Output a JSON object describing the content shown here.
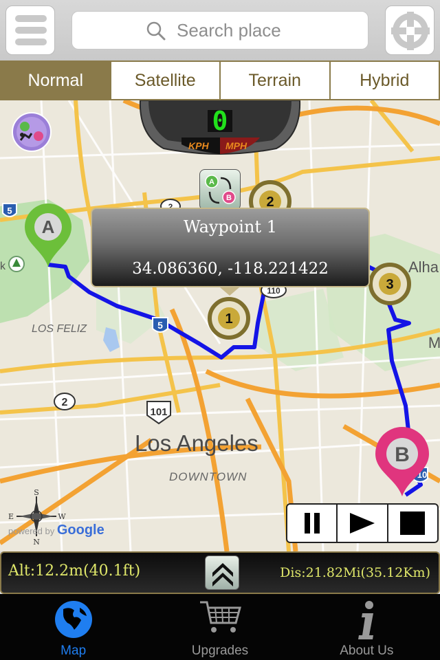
{
  "search": {
    "placeholder": "Search place"
  },
  "map_types": {
    "items": [
      "Normal",
      "Satellite",
      "Terrain",
      "Hybrid"
    ],
    "selected": "Normal"
  },
  "speed": {
    "value": "0",
    "unit_kph": "KPH",
    "unit_mph": "MPH"
  },
  "popup": {
    "title": "Waypoint 1",
    "coords": "34.086360, -118.221422"
  },
  "map_labels": {
    "city": "Los Angeles",
    "downtown": "DOWNTOWN",
    "los_feliz": "LOS FELIZ",
    "alha": "Alha",
    "hwy_101": "101",
    "hwy_2": "2",
    "hwy_5a": "5",
    "hwy_5b": "5",
    "hwy_110": "110",
    "hwy_10": "10",
    "hwy_m": "M",
    "hwy_2b": "2",
    "park_k": "k",
    "google_prefix": "powered by",
    "google": "Google"
  },
  "markers": {
    "start": "A",
    "end": "B",
    "wp1": "1",
    "wp2": "2",
    "wp3": "3"
  },
  "compass": {
    "n": "N",
    "s": "S",
    "e": "E",
    "w": "W"
  },
  "status": {
    "altitude": "Alt:12.2m(40.1ft)",
    "distance": "Dis:21.82Mi(35.12Km)"
  },
  "tabs": {
    "map": "Map",
    "upgrades": "Upgrades",
    "about": "About Us",
    "selected": "Map"
  },
  "colors": {
    "accent": "#8a7a4a",
    "route": "#1414e6",
    "active_tab": "#1f7ef0",
    "status_text": "#e0e86a"
  }
}
